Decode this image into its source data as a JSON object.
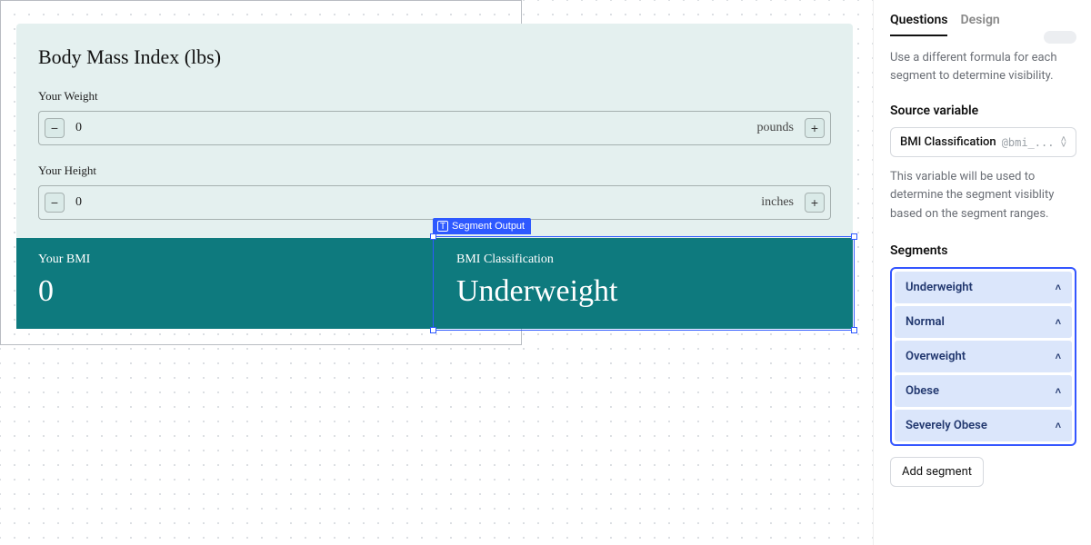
{
  "form": {
    "title": "Body Mass Index (lbs)",
    "weight": {
      "label": "Your Weight",
      "value": "0",
      "unit": "pounds"
    },
    "height": {
      "label": "Your Height",
      "value": "0",
      "unit": "inches"
    },
    "bmi": {
      "label": "Your BMI",
      "value": "0"
    },
    "classification": {
      "label": "BMI Classification",
      "value": "Underweight"
    }
  },
  "selection_tag": {
    "icon": "T",
    "label": "Segment Output"
  },
  "sidebar": {
    "tabs": {
      "questions": "Questions",
      "design": "Design"
    },
    "description": "Use a different formula for each segment to determine visibility.",
    "source": {
      "label": "Source variable",
      "name": "BMI Classification",
      "var": "@bmi_...",
      "help": "This variable will be used to determine the segment visiblity based on the segment ranges."
    },
    "segments_label": "Segments",
    "segments": [
      {
        "label": "Underweight"
      },
      {
        "label": "Normal"
      },
      {
        "label": "Overweight"
      },
      {
        "label": "Obese"
      },
      {
        "label": "Severely Obese"
      }
    ],
    "add_label": "Add segment"
  }
}
